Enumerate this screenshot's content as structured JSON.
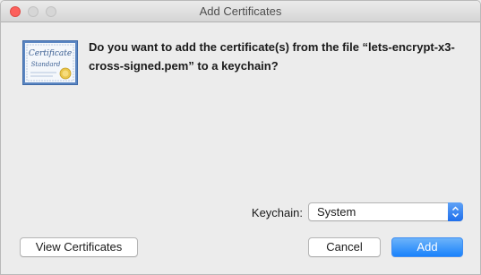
{
  "window": {
    "title": "Add Certificates"
  },
  "dialog": {
    "message": "Do you want to add the certificate(s) from the file “lets-encrypt-x3-cross-signed.pem” to a keychain?",
    "icon": "certificate-icon",
    "icon_text_line1": "Certificate",
    "icon_text_line2": "Standard"
  },
  "keychain": {
    "label": "Keychain:",
    "selected": "System"
  },
  "buttons": {
    "view_certificates": "View Certificates",
    "cancel": "Cancel",
    "add": "Add"
  },
  "colors": {
    "accent": "#1a82fb",
    "close": "#fc605c"
  }
}
